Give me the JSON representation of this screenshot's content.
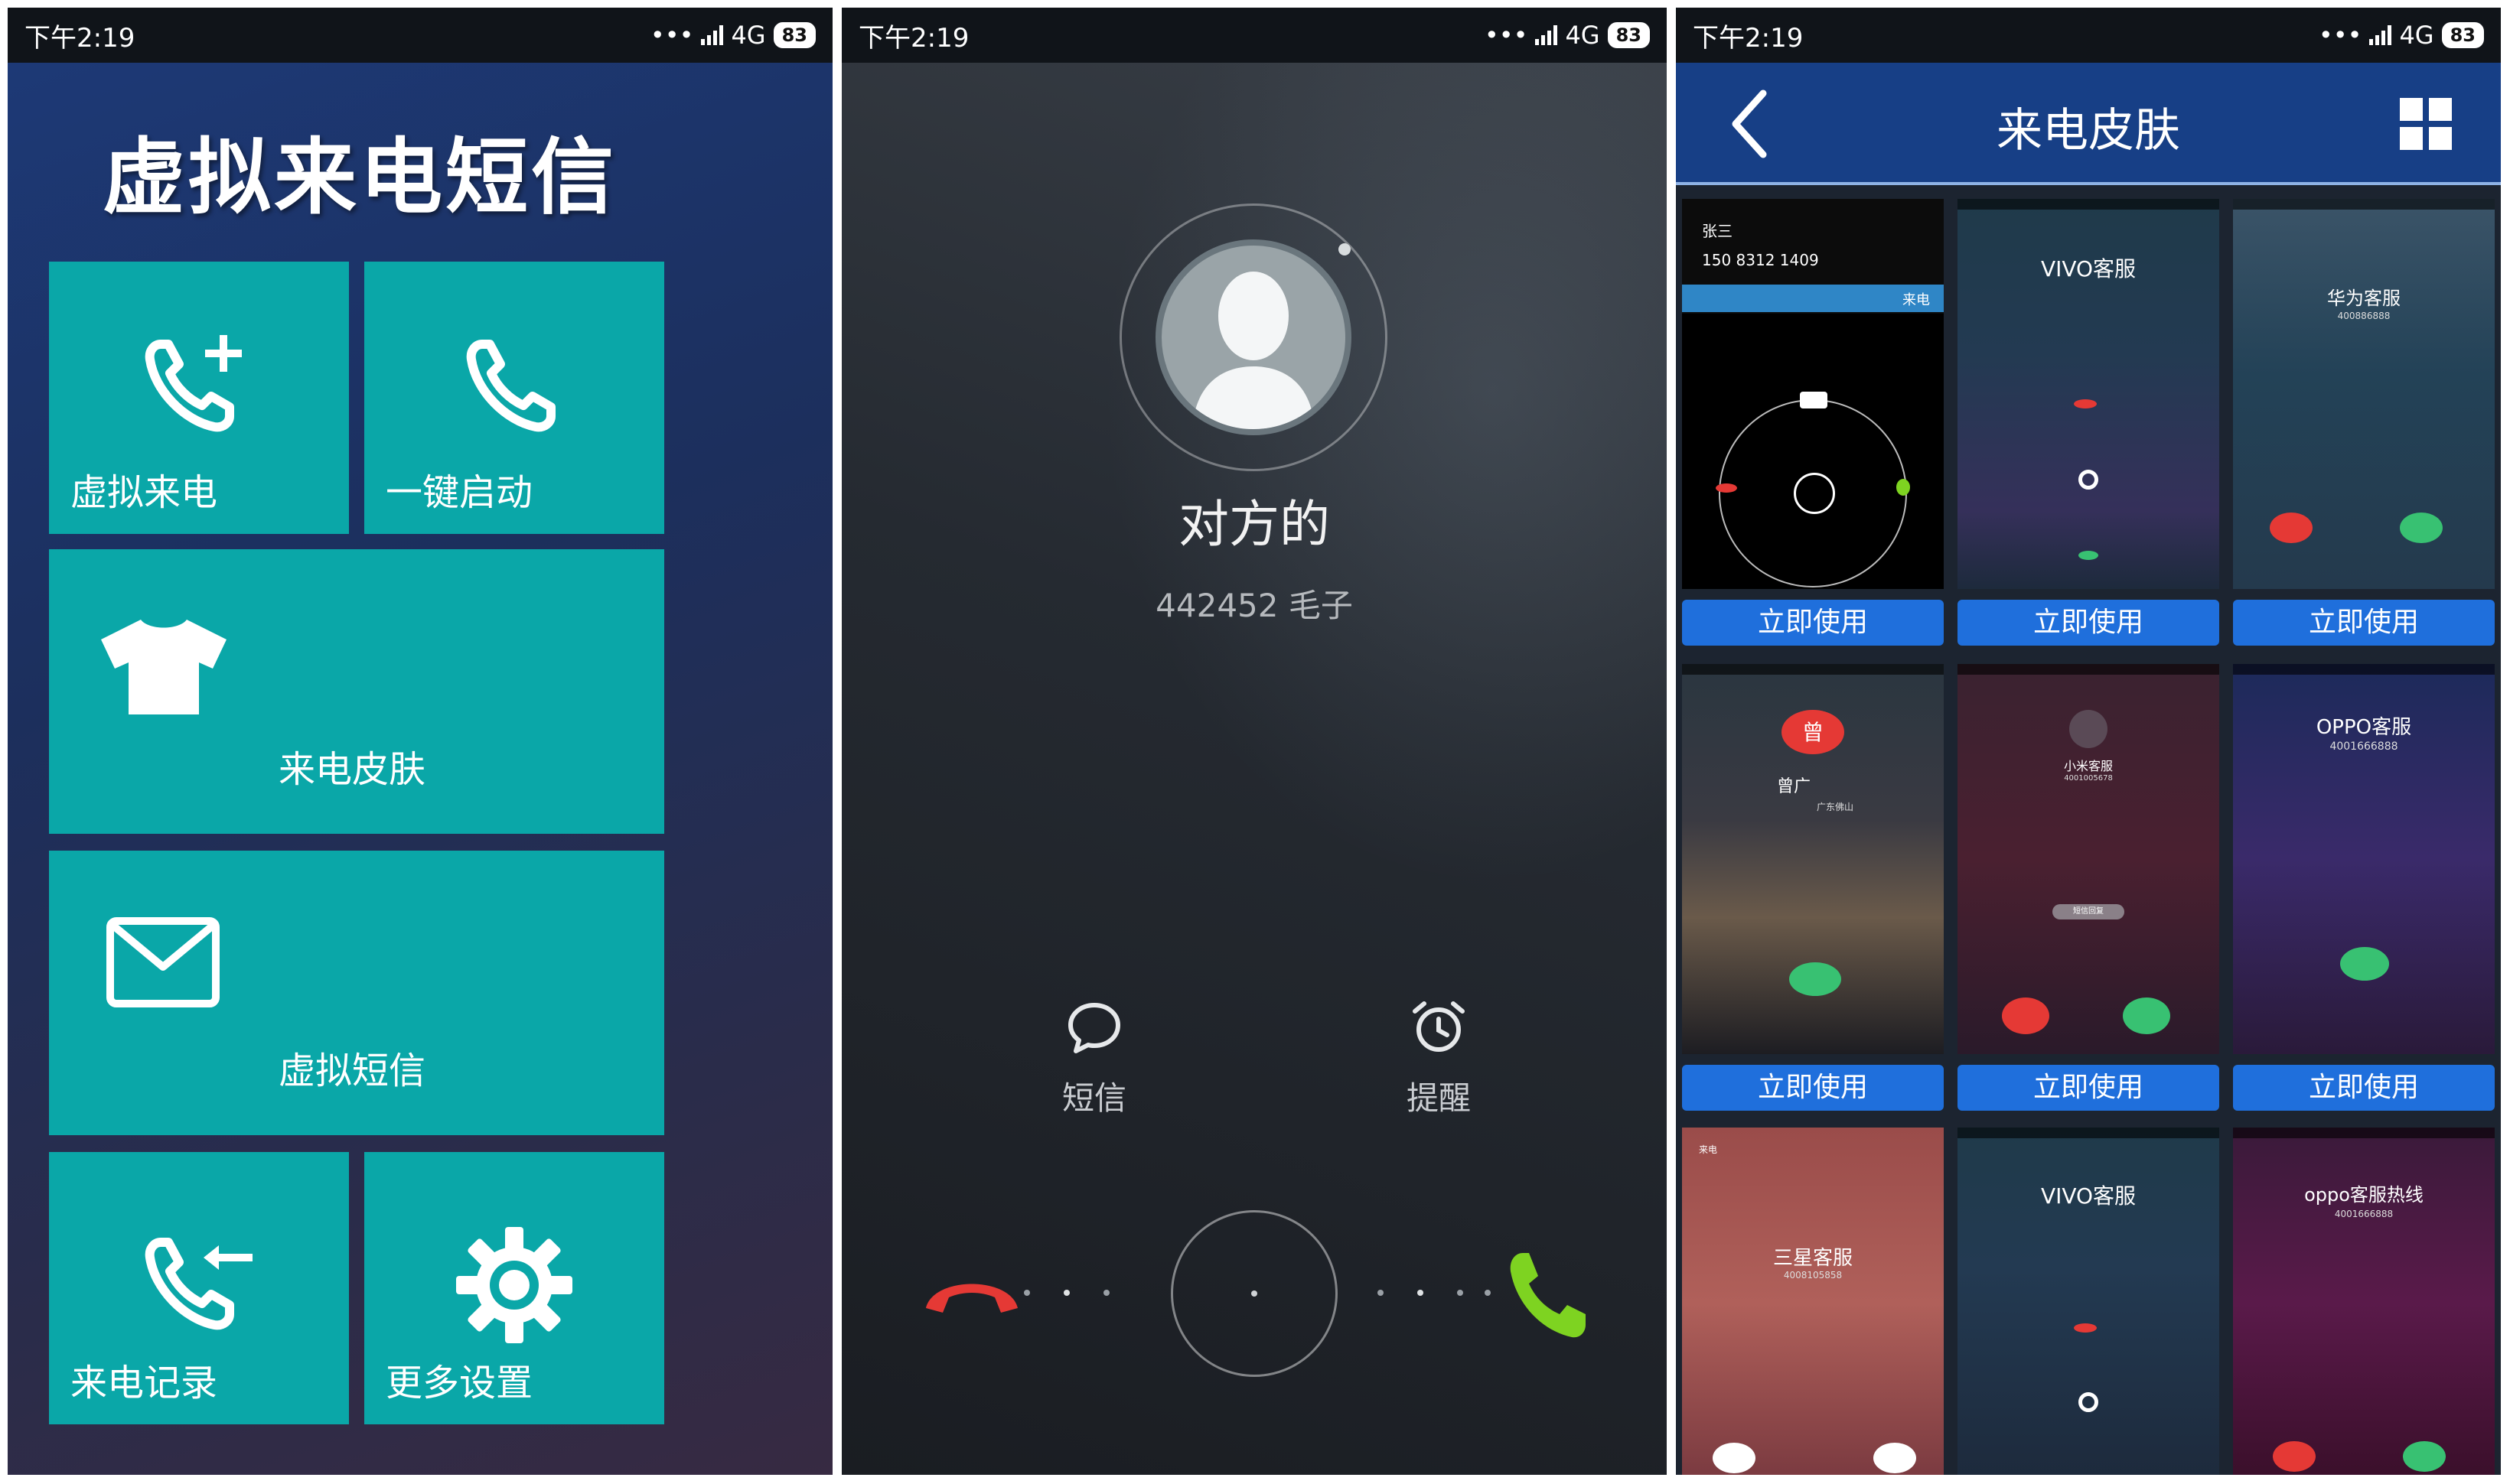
{
  "status_bar": {
    "time": "下午2:19",
    "network": "4G",
    "battery": "83"
  },
  "main_menu": {
    "title": "虚拟来电短信",
    "tiles": {
      "virtual_call": "虚拟来电",
      "one_key_start": "一键启动",
      "call_skin": "来电皮肤",
      "virtual_sms": "虚拟短信",
      "call_log": "来电记录",
      "more_settings": "更多设置"
    },
    "tile_color": "#0aa7a8"
  },
  "incoming_call": {
    "name": "对方的",
    "number": "442452 毛子",
    "sms_label": "短信",
    "remind_label": "提醒",
    "decline_color": "#e53935",
    "answer_color": "#7ed321"
  },
  "skin_page": {
    "title": "来电皮肤",
    "back_icon": "chevron-left-icon",
    "grid_icon": "grid-icon",
    "use_label": "立即使用",
    "skins": [
      {
        "title": "张三",
        "number": "150 8312 1409",
        "tag": "来电"
      },
      {
        "title": "VIVO客服"
      },
      {
        "title": "华为客服",
        "number": "400886888"
      },
      {
        "title": "曾",
        "name": "曾广",
        "location": "广东佛山"
      },
      {
        "title": "小米客服",
        "number": "4001005678",
        "chip": "短信回复"
      },
      {
        "title": "OPPO客服",
        "number": "4001666888"
      },
      {
        "title": "三星客服",
        "number": "4008105858",
        "tag": "来电"
      },
      {
        "title": "VIVO客服"
      },
      {
        "title": "oppo客服热线",
        "number": "4001666888"
      }
    ],
    "button_color": "#1f6fdc"
  }
}
